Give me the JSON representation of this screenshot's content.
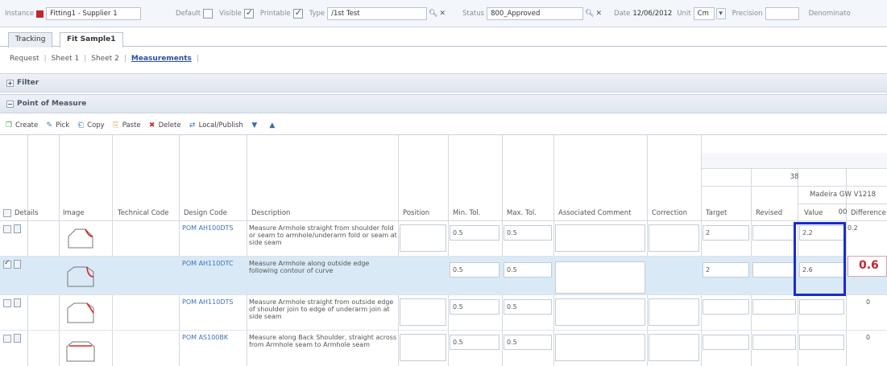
{
  "topbar": {
    "instance_label": "Instance",
    "instance_value": "Fitting1 - Supplier 1",
    "default_label": "Default",
    "visible_label": "Visible",
    "printable_label": "Printable",
    "type_label": "Type",
    "type_value": "/1st Test",
    "status_label": "Status",
    "status_value": "800_Approved",
    "date_label": "Date",
    "date_value": "12/06/2012",
    "unit_label": "Unit",
    "unit_value": "Cm",
    "precision_label": "Precision",
    "denominator_label": "Denominato"
  },
  "tabs": [
    "Tracking",
    "Fit Sample1"
  ],
  "subtabs": [
    "Request",
    "Sheet 1",
    "Sheet 2",
    "Measurements"
  ],
  "sections": {
    "filter": "Filter",
    "pom": "Point of Measure"
  },
  "toolbar": [
    "Create",
    "Pick",
    "Copy",
    "Paste",
    "Delete",
    "Local/Publish"
  ],
  "grid": {
    "columns": [
      "Details",
      "Image",
      "Technical Code",
      "Design Code",
      "Description",
      "Position",
      "Min. Tol.",
      "Max. Tol.",
      "Associated Comment",
      "Correction",
      "Target",
      "Revised",
      "Value",
      "Difference"
    ],
    "group_size": "38",
    "group_sample": "Madeira GW V1218",
    "group_sub": "00",
    "rows": [
      {
        "design_code": "POM AH100DTS",
        "description": "Measure Armhole straight from shoulder fold or seam to armhole/underarm fold or seam at side seam",
        "min_tol": "0.5",
        "max_tol": "0.5",
        "target": "2",
        "value": "2.2",
        "difference": "0.2"
      },
      {
        "design_code": "POM AH110DTC",
        "description": "Measure Armhole along outside edge following contour of curve",
        "min_tol": "0.5",
        "max_tol": "0.5",
        "target": "2",
        "value": "2.6",
        "difference": "0.6"
      },
      {
        "design_code": "POM AH110DTS",
        "description": "Measure Armhole straight from outside edge of shoulder join to edge of underarm join at side seam",
        "min_tol": "0.5",
        "max_tol": "0.5",
        "target": "",
        "value": "",
        "difference": "0"
      },
      {
        "design_code": "POM AS100BK",
        "description": "Measure along Back Shoulder, straight across from Armhole seam to Armhole seam",
        "min_tol": "0.5",
        "max_tol": "0.5",
        "target": "",
        "value": "",
        "difference": "0"
      }
    ]
  },
  "colors": {
    "link": "#3f71b9",
    "selected_row": "#d9e9f6",
    "highlight_box": "#1a2bd1",
    "difference_red": "#c7242e"
  }
}
